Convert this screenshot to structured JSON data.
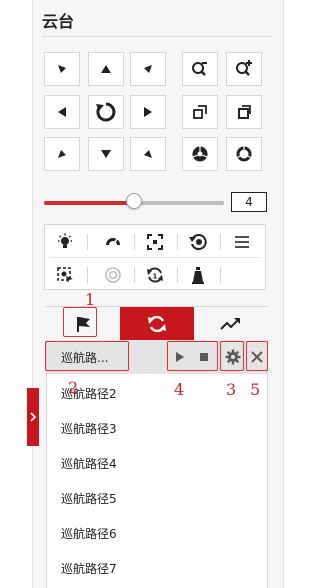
{
  "panel": {
    "title": "云台"
  },
  "direction_pad": {
    "buttons": [
      {
        "name": "up-left",
        "icon": "arrow-up-left-icon"
      },
      {
        "name": "up",
        "icon": "arrow-up-icon"
      },
      {
        "name": "up-right",
        "icon": "arrow-up-right-icon"
      },
      {
        "name": "left",
        "icon": "arrow-left-icon"
      },
      {
        "name": "auto-scan",
        "icon": "rotate-icon"
      },
      {
        "name": "right",
        "icon": "arrow-right-icon"
      },
      {
        "name": "down-left",
        "icon": "arrow-down-left-icon"
      },
      {
        "name": "down",
        "icon": "arrow-down-icon"
      },
      {
        "name": "down-right",
        "icon": "arrow-down-right-icon"
      }
    ]
  },
  "lens_controls": {
    "buttons": [
      {
        "name": "zoom-out",
        "icon": "zoom-out-icon"
      },
      {
        "name": "zoom-in",
        "icon": "zoom-in-icon"
      },
      {
        "name": "focus-near",
        "icon": "focus-near-icon"
      },
      {
        "name": "focus-far",
        "icon": "focus-far-icon"
      },
      {
        "name": "iris-close",
        "icon": "iris-close-icon"
      },
      {
        "name": "iris-open",
        "icon": "iris-open-icon"
      }
    ]
  },
  "speed": {
    "value": "4",
    "level_fraction": 0.5,
    "fill_color": "#d32f2f"
  },
  "functions": {
    "icons": [
      "light-icon",
      "wiper-icon",
      "aux-focus-icon",
      "lens-init-icon",
      "menu-icon",
      "manual-track-icon",
      "zoom-3d-icon",
      "park-icon",
      "one-touch-icon"
    ]
  },
  "tabs": {
    "items": [
      "preset-flag-icon",
      "patrol-icon",
      "pattern-icon"
    ],
    "active_index": 1,
    "active_color": "#c8161d"
  },
  "patrol_list": {
    "items": [
      "巡航路...",
      "巡航路径2",
      "巡航路径3",
      "巡航路径4",
      "巡航路径5",
      "巡航路径6",
      "巡航路径7"
    ],
    "selected_index": 0
  },
  "annotations": {
    "a1": "1",
    "a2": "2",
    "a3": "3",
    "a4": "4",
    "a5": "5",
    "color": "#c62828"
  }
}
